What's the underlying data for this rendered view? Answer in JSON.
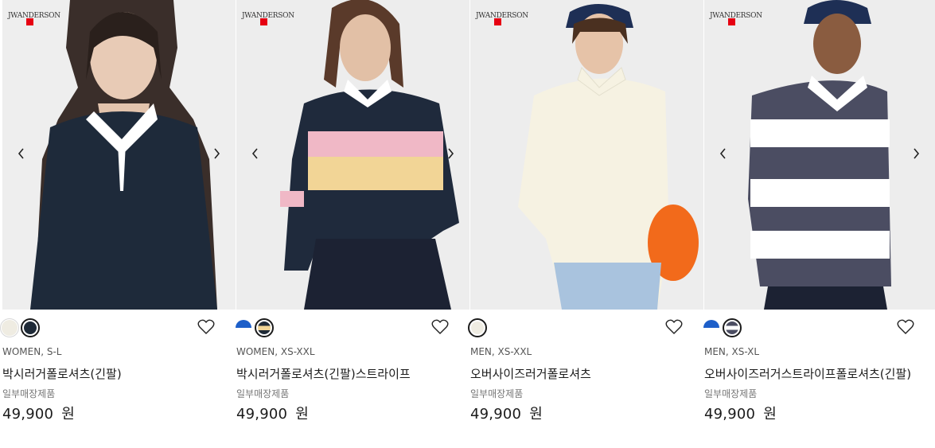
{
  "brand": {
    "logo_text": "JWANDERSON"
  },
  "colors": {
    "uniqlo_red": "#e60012",
    "text_primary": "#1b1b1b",
    "text_secondary": "#767676"
  },
  "products": [
    {
      "swatches": [
        {
          "color": "#efece2",
          "selected": false
        },
        {
          "color": "#1f2a37",
          "selected": true
        }
      ],
      "gender_size": "WOMEN, S-L",
      "name": "박시러거폴로셔츠(긴팔)",
      "stock_note": "일부매장제품",
      "price": "49,900",
      "currency": "원"
    },
    {
      "swatches": [
        {
          "color": "#1d5fc9",
          "color2": "#ffffff",
          "selected": false
        },
        {
          "color": "#1f2a37",
          "color2": "#f2d596",
          "selected": true
        }
      ],
      "gender_size": "WOMEN, XS-XXL",
      "name": "박시러거폴로셔츠(긴팔)스트라이프",
      "stock_note": "일부매장제품",
      "price": "49,900",
      "currency": "원"
    },
    {
      "swatches": [
        {
          "color": "#efece2",
          "selected": true
        }
      ],
      "gender_size": "MEN, XS-XXL",
      "name": "오버사이즈러거폴로셔츠",
      "stock_note": "일부매장제품",
      "price": "49,900",
      "currency": "원"
    },
    {
      "swatches": [
        {
          "color": "#1d5fc9",
          "color2": "#ffffff",
          "selected": false
        },
        {
          "color": "#4b4d62",
          "color2": "#ffffff",
          "selected": true
        }
      ],
      "gender_size": "MEN, XS-XL",
      "name": "오버사이즈러거스트라이프폴로셔츠(긴팔)",
      "stock_note": "일부매장제품",
      "price": "49,900",
      "currency": "원"
    }
  ]
}
